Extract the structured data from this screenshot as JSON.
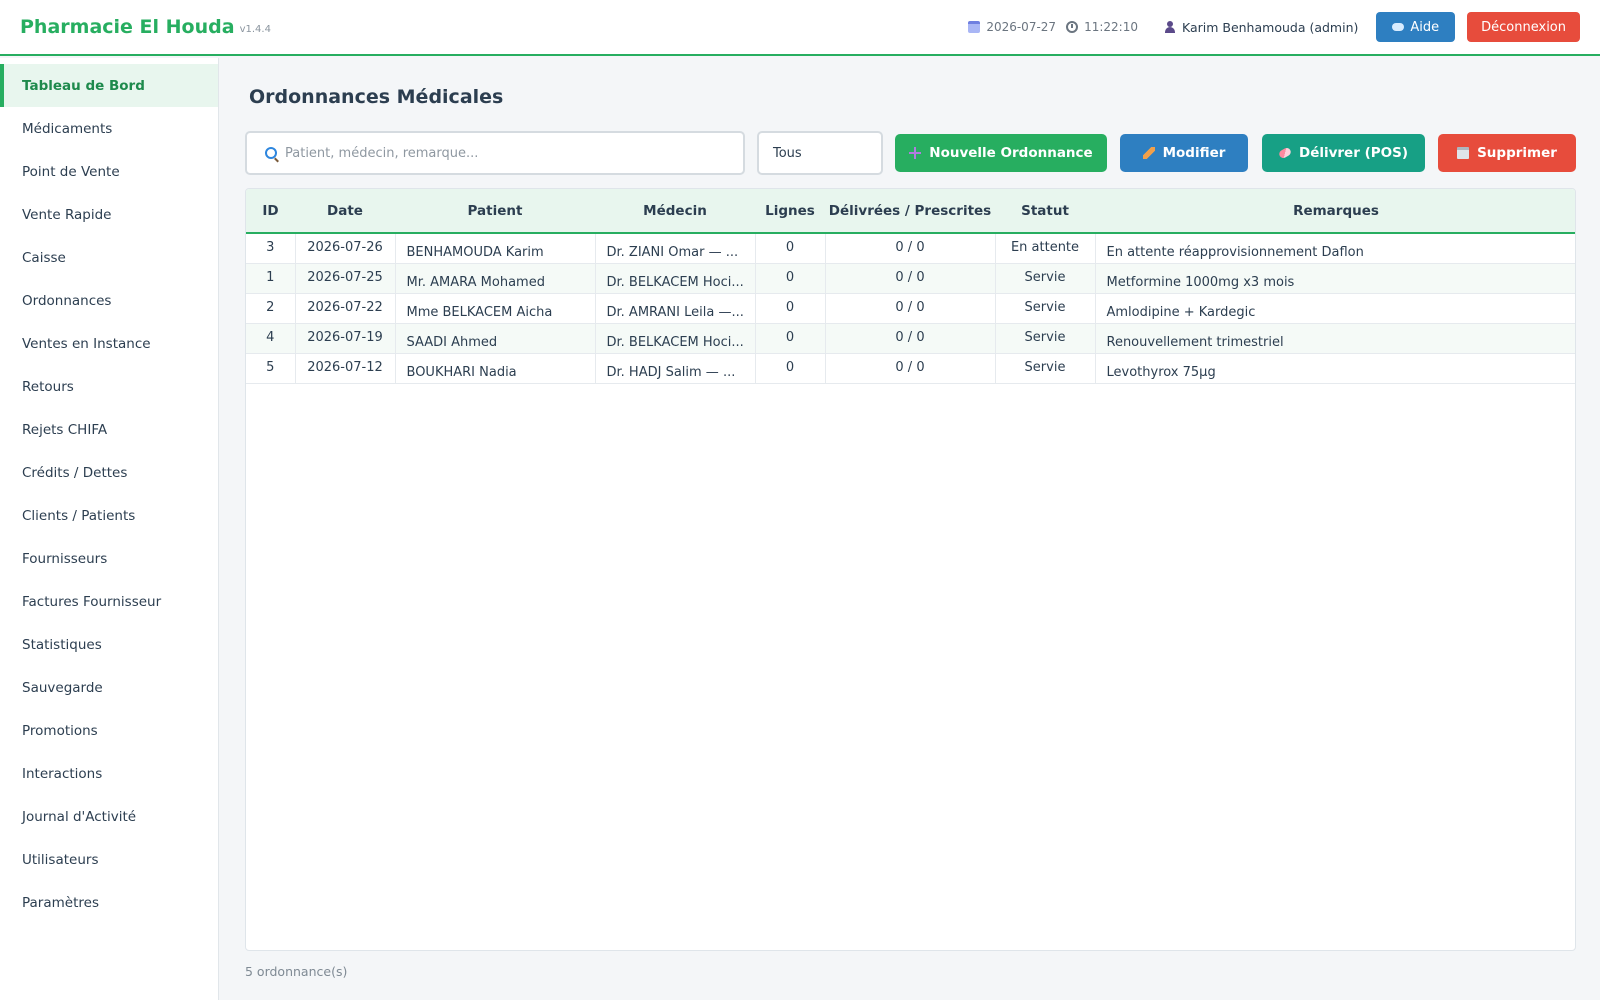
{
  "app": {
    "name": "Pharmacie El Houda",
    "version": "v1.4.4"
  },
  "header": {
    "date": "2026-07-27",
    "time": "11:22:10",
    "user": "Karim Benhamouda (admin)",
    "help_label": "Aide",
    "logout_label": "Déconnexion"
  },
  "sidebar": {
    "items": [
      {
        "label": "Tableau de Bord",
        "active": true
      },
      {
        "label": "Médicaments"
      },
      {
        "label": "Point de Vente"
      },
      {
        "label": "Vente Rapide"
      },
      {
        "label": "Caisse"
      },
      {
        "label": "Ordonnances"
      },
      {
        "label": "Ventes en Instance"
      },
      {
        "label": "Retours"
      },
      {
        "label": "Rejets CHIFA"
      },
      {
        "label": "Crédits / Dettes"
      },
      {
        "label": "Clients / Patients"
      },
      {
        "label": "Fournisseurs"
      },
      {
        "label": "Factures Fournisseur"
      },
      {
        "label": "Statistiques"
      },
      {
        "label": "Sauvegarde"
      },
      {
        "label": "Promotions"
      },
      {
        "label": "Interactions"
      },
      {
        "label": "Journal d'Activité"
      },
      {
        "label": "Utilisateurs"
      },
      {
        "label": "Paramètres"
      }
    ]
  },
  "page": {
    "title": "Ordonnances Médicales",
    "search_placeholder": "Patient, médecin, remarque...",
    "filter_value": "Tous",
    "buttons": {
      "new": "Nouvelle Ordonnance",
      "edit": "Modifier",
      "deliver": "Délivrer (POS)",
      "delete": "Supprimer"
    },
    "count_label": "5 ordonnance(s)"
  },
  "table": {
    "columns": [
      "ID",
      "Date",
      "Patient",
      "Médecin",
      "Lignes",
      "Délivrées / Prescrites",
      "Statut",
      "Remarques"
    ],
    "rows": [
      [
        "3",
        "2026-07-26",
        "BENHAMOUDA Karim",
        "Dr. ZIANI Omar — ...",
        "0",
        "0 / 0",
        "En attente",
        "En attente réapprovisionnement Daflon"
      ],
      [
        "1",
        "2026-07-25",
        "Mr. AMARA Mohamed",
        "Dr. BELKACEM Hoci...",
        "0",
        "0 / 0",
        "Servie",
        "Metformine 1000mg x3 mois"
      ],
      [
        "2",
        "2026-07-22",
        "Mme BELKACEM Aicha",
        "Dr. AMRANI Leila —...",
        "0",
        "0 / 0",
        "Servie",
        "Amlodipine + Kardegic"
      ],
      [
        "4",
        "2026-07-19",
        "SAADI Ahmed",
        "Dr. BELKACEM Hoci...",
        "0",
        "0 / 0",
        "Servie",
        "Renouvellement trimestriel"
      ],
      [
        "5",
        "2026-07-12",
        "BOUKHARI Nadia",
        "Dr. HADJ Salim — ...",
        "0",
        "0 / 0",
        "Servie",
        "Levothyrox 75µg"
      ]
    ]
  },
  "colors": {
    "accent": "#27ae60",
    "primary": "#2e7fc1",
    "teal": "#17a085",
    "danger": "#e74c3c"
  }
}
